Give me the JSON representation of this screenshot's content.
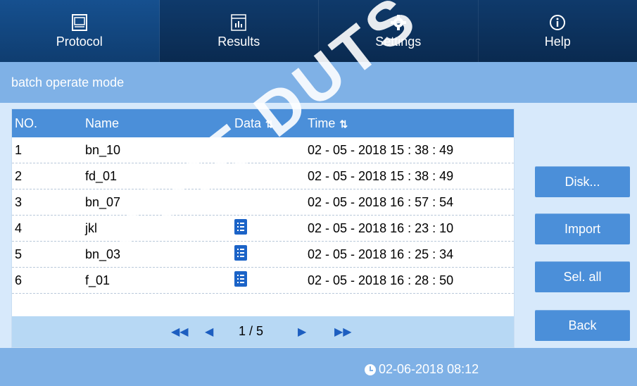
{
  "nav": {
    "tabs": [
      {
        "label": "Protocol",
        "icon": "protocol-icon",
        "active": true
      },
      {
        "label": "Results",
        "icon": "results-chart-icon",
        "active": false
      },
      {
        "label": "Settings",
        "icon": "gear-icon",
        "active": false
      },
      {
        "label": "Help",
        "icon": "info-icon",
        "active": false
      }
    ]
  },
  "mode": {
    "title": "batch operate mode"
  },
  "table": {
    "headers": {
      "no": "NO.",
      "name": "Name",
      "data": "Data",
      "time": "Time"
    },
    "rows": [
      {
        "no": "1",
        "name": "bn_10",
        "has_data": false,
        "time": "02 - 05 - 2018 15 : 38 : 49"
      },
      {
        "no": "2",
        "name": "fd_01",
        "has_data": false,
        "time": "02 - 05 - 2018 15 : 38 : 49"
      },
      {
        "no": "3",
        "name": "bn_07",
        "has_data": false,
        "time": "02 - 05 - 2018 16 : 57 : 54"
      },
      {
        "no": "4",
        "name": "jkl",
        "has_data": true,
        "time": "02 - 05 - 2018 16 : 23 : 10"
      },
      {
        "no": "5",
        "name": "bn_03",
        "has_data": true,
        "time": "02 - 05 - 2018 16 : 25 : 34"
      },
      {
        "no": "6",
        "name": "f_01",
        "has_data": true,
        "time": "02 - 05 - 2018 16 : 28 : 50"
      }
    ]
  },
  "pager": {
    "page": "1 / 5"
  },
  "buttons": {
    "disk": "Disk...",
    "import": "Import",
    "select_all": "Sel. all",
    "back": "Back"
  },
  "status": {
    "datetime": "02-06-2018 08:12"
  },
  "watermark": "IQUE DUTS",
  "colors": {
    "nav_bg": "#0f3a6b",
    "accent": "#4b8fd9",
    "panel_bg": "#d7e9fb",
    "mode_bar": "#7fb1e6"
  }
}
